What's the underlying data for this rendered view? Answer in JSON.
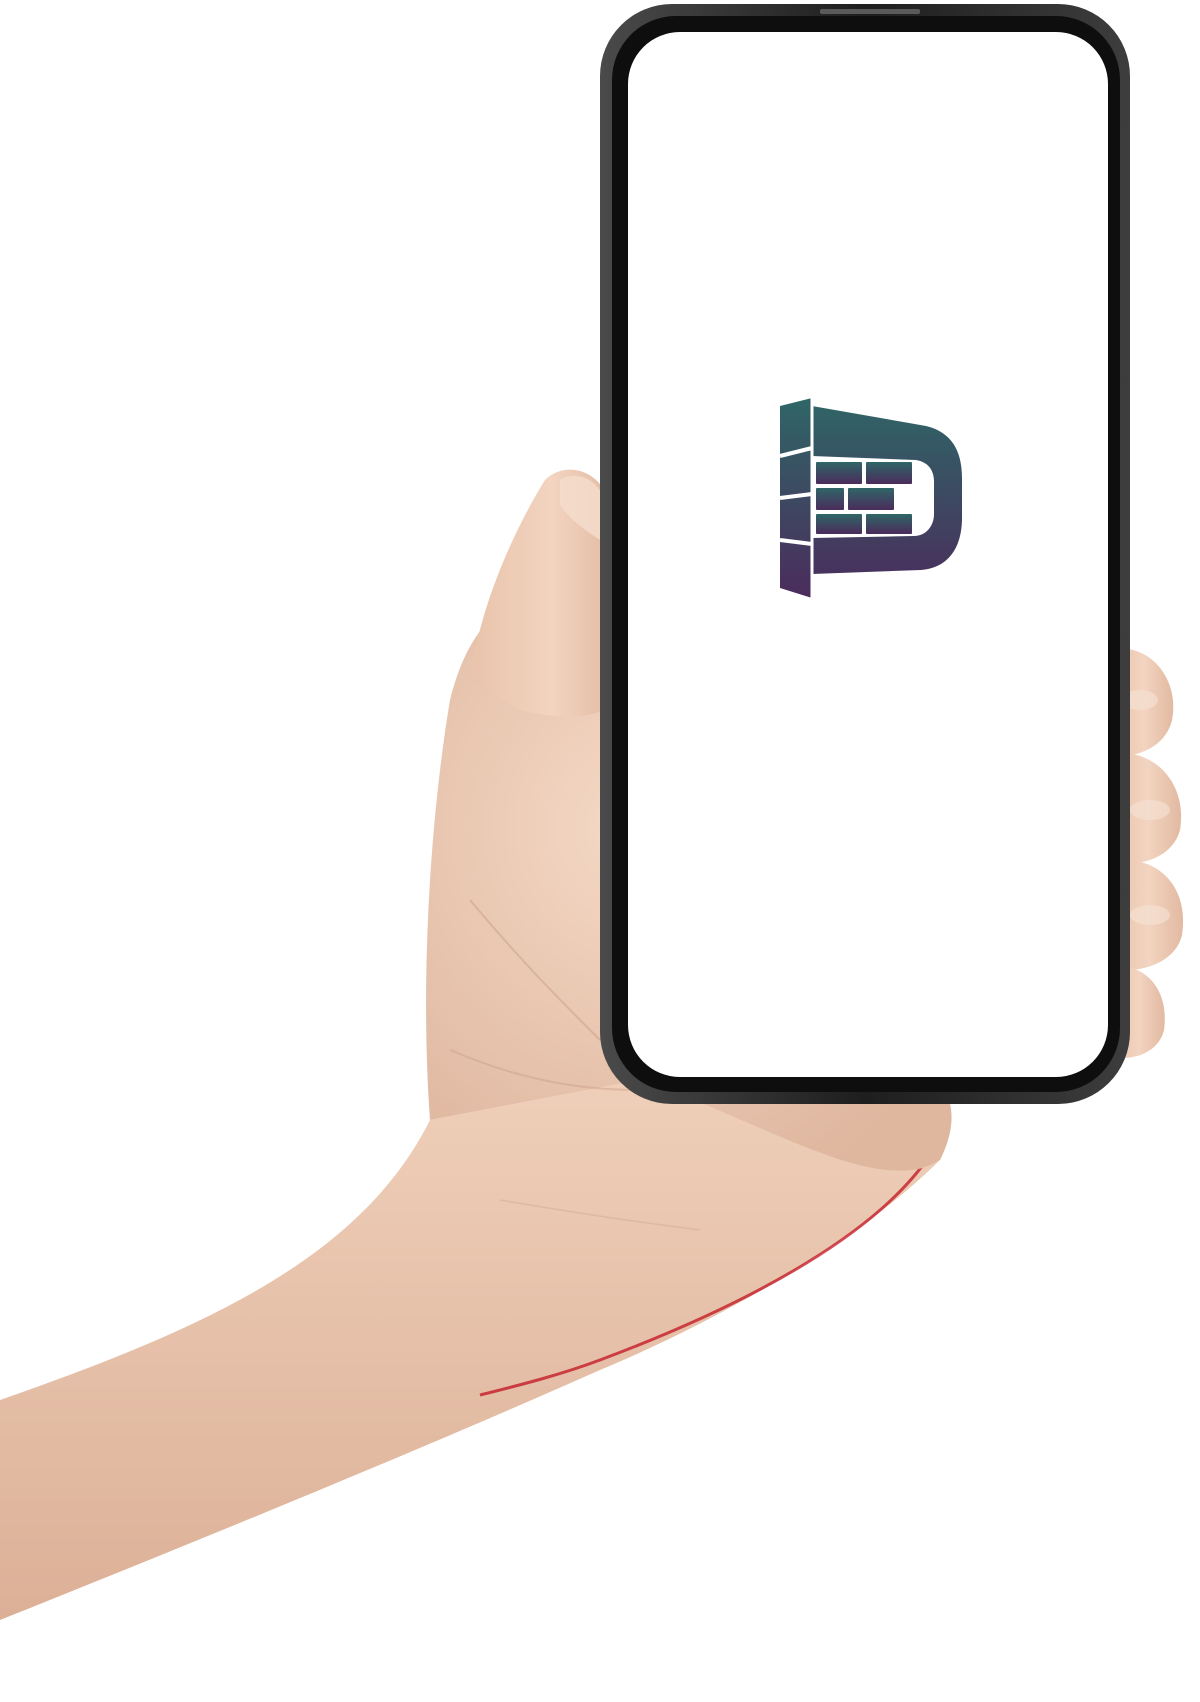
{
  "scene": {
    "description_items": [
      "hand",
      "smartphone"
    ],
    "screen": {
      "background": "#ffffff",
      "logo": {
        "icon": "brick-d-logo-icon",
        "gradient_top": "#2f6667",
        "gradient_bottom": "#4b2c5c"
      }
    },
    "colors": {
      "skin_light": "#f1d3bf",
      "skin_mid": "#e6bfa8",
      "skin_shadow": "#c99d87",
      "phone_frame": "#2a2a2a",
      "phone_bezel": "#111111",
      "accent_sleeve_edge": "#c1121f"
    }
  }
}
